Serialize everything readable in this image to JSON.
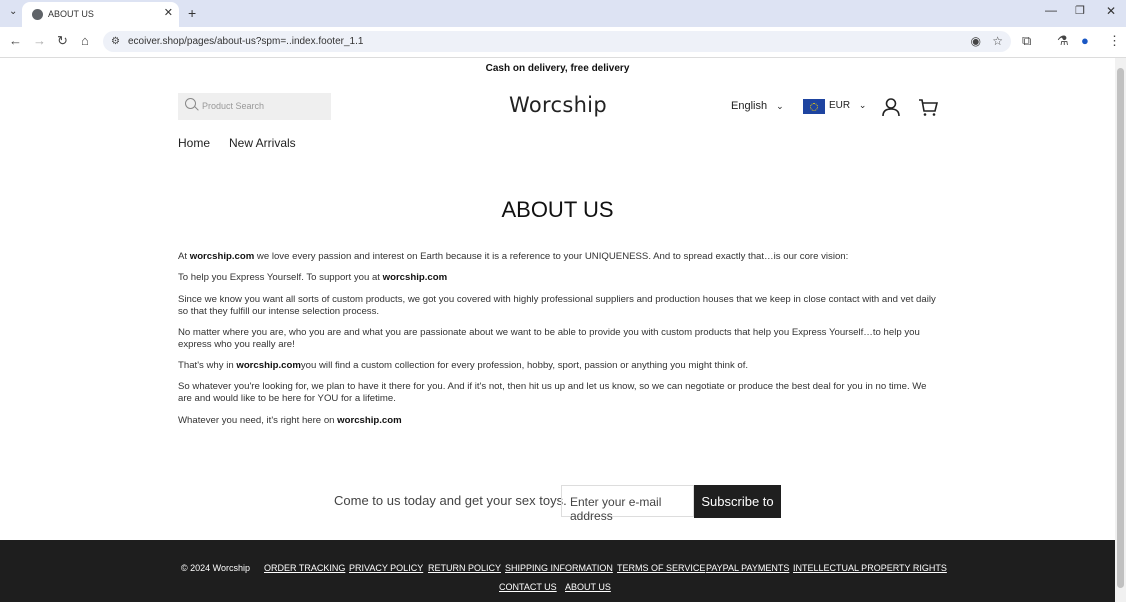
{
  "browser": {
    "tab_title": "ABOUT US",
    "url": "ecoiver.shop/pages/about-us?spm=..index.footer_1.1",
    "new_tab": "+",
    "close_tab": "✕"
  },
  "page": {
    "announcement": "Cash on delivery, free delivery",
    "search_placeholder": "Product Search",
    "logo": "Worcship",
    "language": "English",
    "currency": "EUR",
    "nav": [
      "Home",
      "New Arrivals"
    ],
    "title": "ABOUT US",
    "paragraphs": [
      {
        "pre": "At ",
        "bold": "worcship.com",
        "post": " we love every passion and interest on Earth because it is a reference to your UNIQUENESS. And to spread exactly that…is our core vision:"
      },
      {
        "pre": "To help you Express Yourself. To support you at ",
        "bold": "worcship.com",
        "post": ""
      },
      {
        "pre": "Since we know you want all sorts of custom products, we got you covered with highly professional suppliers and production houses that we keep in close contact with and vet daily so that they fulfill our intense selection process.",
        "bold": "",
        "post": ""
      },
      {
        "pre": "No matter where you are, who you are and what you are passionate about we want to be able to provide you with custom products that help you Express Yourself…to help you express who you really are!",
        "bold": "",
        "post": ""
      },
      {
        "pre": "That's why in ",
        "bold": "worcship.com",
        "post": "you will find a custom collection for every profession, hobby, sport, passion or anything you might think of."
      },
      {
        "pre": "So whatever you're looking for, we plan to have it there for you. And if it's not, then hit us up and let us know, so we can negotiate or produce the best deal for you in no time. We are and would like to be here for YOU for a lifetime.",
        "bold": "",
        "post": ""
      },
      {
        "pre": "Whatever you need, it's right here on ",
        "bold": "worcship.com",
        "post": ""
      }
    ],
    "subscribe_text": "Come to us today and get your sex toys.",
    "email_placeholder": "Enter your e-mail address",
    "subscribe_button": "Subscribe to"
  },
  "footer": {
    "copyright": "© 2024 Worcship",
    "links": [
      "ORDER TRACKING",
      "PRIVACY POLICY",
      "RETURN POLICY",
      "SHIPPING INFORMATION",
      "TERMS OF SERVICE",
      "PAYPAL PAYMENTS",
      "INTELLECTUAL PROPERTY RIGHTS",
      "CONTACT US",
      "ABOUT US"
    ]
  },
  "colors": {
    "chrome_bg": "#dde3f3",
    "footer_bg": "#1e1e1e",
    "button_bg": "#1f1f1f"
  }
}
